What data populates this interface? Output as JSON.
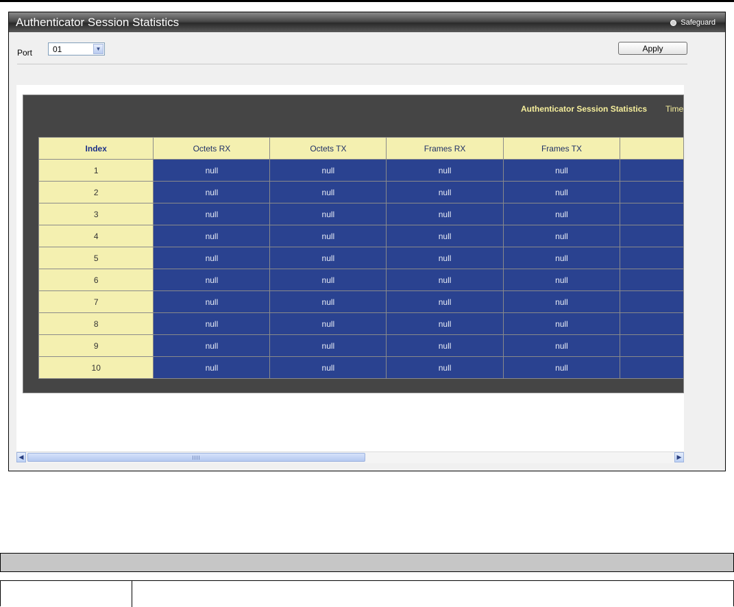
{
  "window": {
    "title": "Authenticator Session Statistics",
    "safeguard_label": "Safeguard"
  },
  "form": {
    "port_label": "Port",
    "port_value": "01",
    "apply_label": "Apply"
  },
  "stats": {
    "title": "Authenticator Session Statistics",
    "time_label": "Time",
    "columns": [
      "Index",
      "Octets RX",
      "Octets TX",
      "Frames RX",
      "Frames TX",
      ""
    ],
    "rows": [
      {
        "index": "1",
        "values": [
          "null",
          "null",
          "null",
          "null",
          ""
        ]
      },
      {
        "index": "2",
        "values": [
          "null",
          "null",
          "null",
          "null",
          ""
        ]
      },
      {
        "index": "3",
        "values": [
          "null",
          "null",
          "null",
          "null",
          ""
        ]
      },
      {
        "index": "4",
        "values": [
          "null",
          "null",
          "null",
          "null",
          ""
        ]
      },
      {
        "index": "5",
        "values": [
          "null",
          "null",
          "null",
          "null",
          ""
        ]
      },
      {
        "index": "6",
        "values": [
          "null",
          "null",
          "null",
          "null",
          ""
        ]
      },
      {
        "index": "7",
        "values": [
          "null",
          "null",
          "null",
          "null",
          ""
        ]
      },
      {
        "index": "8",
        "values": [
          "null",
          "null",
          "null",
          "null",
          ""
        ]
      },
      {
        "index": "9",
        "values": [
          "null",
          "null",
          "null",
          "null",
          ""
        ]
      },
      {
        "index": "10",
        "values": [
          "null",
          "null",
          "null",
          "null",
          ""
        ]
      }
    ]
  },
  "icons": {
    "safeguard": "status-dot-icon",
    "select_arrow": "chevron-down-icon",
    "scroll_left": "arrow-left-icon",
    "scroll_right": "arrow-right-icon"
  },
  "colors": {
    "title_bar": "#3c3c3c",
    "panel_bg": "#454545",
    "header_cell": "#f4f0b0",
    "data_cell": "#2a4290",
    "stats_title": "#f6ef9c"
  }
}
